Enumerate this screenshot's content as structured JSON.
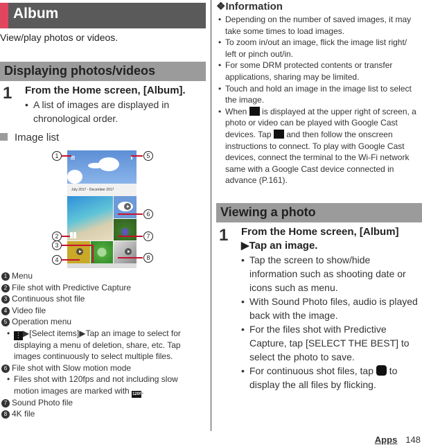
{
  "page": {
    "title": "Album",
    "lead": "View/play photos or videos.",
    "footer": {
      "section": "Apps",
      "page_number": "148"
    },
    "accent_color": "#e0475f"
  },
  "left": {
    "section_title": "Displaying photos/videos",
    "step": {
      "number": "1",
      "text": "From the Home screen, [Album].",
      "bullets": [
        "A list of images are displayed in chronological order."
      ]
    },
    "subheading": "Image list",
    "screenshot": {
      "date_range": "July 2017 - December 2017",
      "callouts": [
        "1",
        "2",
        "3",
        "4",
        "5",
        "6",
        "7",
        "8"
      ]
    },
    "legend": [
      {
        "num": "1",
        "label": "Menu"
      },
      {
        "num": "2",
        "label": "File shot with Predictive Capture"
      },
      {
        "num": "3",
        "label": "Continuous shot file"
      },
      {
        "num": "4",
        "label": "Video file"
      },
      {
        "num": "5",
        "label": "Operation menu"
      },
      {
        "num": "6",
        "label": "File shot with Slow motion mode"
      },
      {
        "num": "7",
        "label": "Sound Photo file"
      },
      {
        "num": "8",
        "label": "4K file"
      }
    ],
    "operation_menu_note": {
      "part1": "[Select items]",
      "part2": "Tap an image to select for",
      "line2": "displaying a menu of deletion, share, etc. Tap",
      "line3": "images continuously to select multiple files."
    },
    "slow_motion_note": {
      "line1": "Files shot with 120fps and not including slow",
      "line2": "motion images are marked with",
      "icon_label": "120f",
      "line2_end": "."
    }
  },
  "right": {
    "info_title": "Information",
    "info_bullets": [
      [
        "Depending on the number of saved images, it may",
        "take some times to load images."
      ],
      [
        "To zoom in/out an image, flick the image list right/",
        "left or pinch out/in."
      ],
      [
        "For some DRM protected contents or transfer",
        "applications, sharing may be limited."
      ],
      [
        "Touch and hold an image in the image list to select",
        "the image."
      ]
    ],
    "cast_bullet": {
      "l1a": "When",
      "l1b": "is displayed at the upper right of screen, a",
      "l2": "photo or video can be played with Google Cast",
      "l3a": "devices. Tap",
      "l3b": "and then follow the onscreen",
      "l4": "instructions to connect. To play with Google Cast",
      "l5": "devices, connect the terminal to the Wi-Fi network",
      "l6": "same with a Google Cast device connected in",
      "l7": "advance (P.161)."
    },
    "section_title": "Viewing a photo",
    "step": {
      "number": "1",
      "line1": "From the Home screen, [Album]",
      "line2": "Tap an image.",
      "bullets": [
        [
          "Tap the screen to show/hide",
          "information such as shooting date or",
          "icons such as menu."
        ],
        [
          "With Sound Photo files, audio is played",
          "back with the image."
        ],
        [
          "For the files shot with Predictive",
          "Capture, tap [SELECT THE BEST] to",
          "select the photo to save."
        ]
      ],
      "last_bullet": {
        "a": "For continuous shot files, tap",
        "b": "to",
        "c": "display the all files by flicking."
      }
    }
  }
}
